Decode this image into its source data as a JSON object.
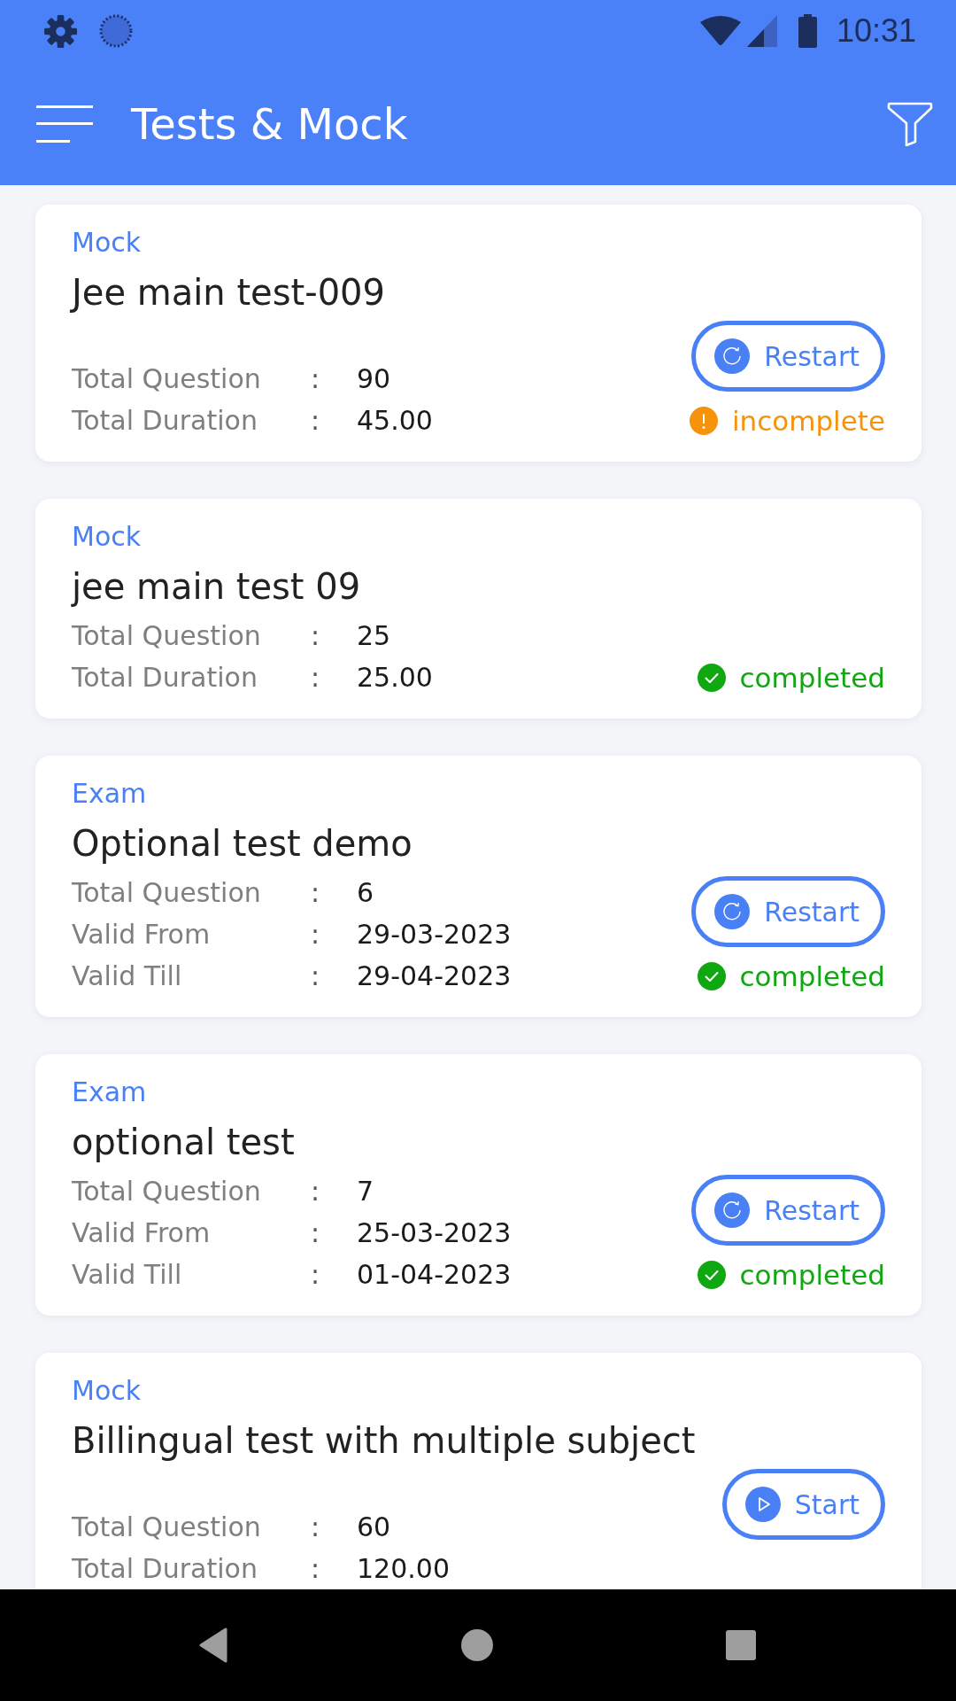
{
  "status_bar": {
    "time": "10:31"
  },
  "app_bar": {
    "title": "Tests & Mock"
  },
  "tests": [
    {
      "type": "Mock",
      "title": "Jee main test-009",
      "details": [
        {
          "label": "Total Question",
          "separator": ":",
          "value": "90"
        },
        {
          "label": "Total Duration",
          "separator": ":",
          "value": "45.00"
        }
      ],
      "action": {
        "kind": "restart",
        "label": "Restart"
      },
      "status": {
        "kind": "incomplete",
        "label": "incomplete"
      }
    },
    {
      "type": "Mock",
      "title": "jee main test 09",
      "details": [
        {
          "label": "Total Question",
          "separator": ":",
          "value": "25"
        },
        {
          "label": "Total Duration",
          "separator": ":",
          "value": "25.00"
        }
      ],
      "status": {
        "kind": "completed",
        "label": "completed"
      }
    },
    {
      "type": "Exam",
      "title": "Optional test demo",
      "details": [
        {
          "label": "Total Question",
          "separator": ":",
          "value": "6"
        },
        {
          "label": "Valid From",
          "separator": ":",
          "value": "29-03-2023"
        },
        {
          "label": "Valid Till",
          "separator": ":",
          "value": "29-04-2023"
        }
      ],
      "action": {
        "kind": "restart",
        "label": "Restart"
      },
      "status": {
        "kind": "completed",
        "label": "completed"
      }
    },
    {
      "type": "Exam",
      "title": "optional test",
      "details": [
        {
          "label": "Total Question",
          "separator": ":",
          "value": "7"
        },
        {
          "label": "Valid From",
          "separator": ":",
          "value": "25-03-2023"
        },
        {
          "label": "Valid Till",
          "separator": ":",
          "value": "01-04-2023"
        }
      ],
      "action": {
        "kind": "restart",
        "label": "Restart"
      },
      "status": {
        "kind": "completed",
        "label": "completed"
      }
    },
    {
      "type": "Mock",
      "title": "Billingual test with multiple subject",
      "details": [
        {
          "label": "Total Question",
          "separator": ":",
          "value": "60"
        },
        {
          "label": "Total Duration",
          "separator": ":",
          "value": "120.00"
        }
      ],
      "action": {
        "kind": "start",
        "label": "Start"
      }
    }
  ]
}
